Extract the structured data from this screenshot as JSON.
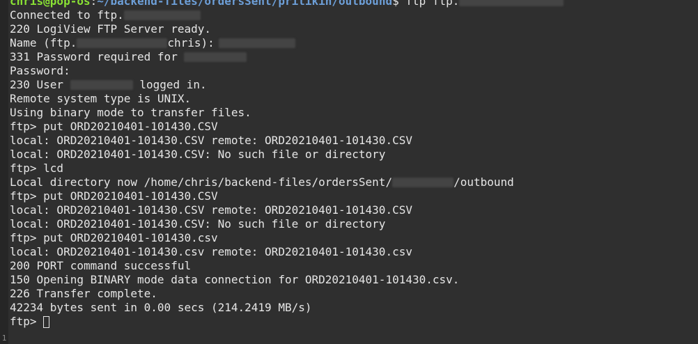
{
  "terminal": {
    "gutter_line_number": "1",
    "prompt": {
      "user_host": "chris@pop-os",
      "separator": ":",
      "path": "~/backend-files/ordersSent/pritikin/outbound",
      "symbol": "$ ",
      "command": "ftp ftp."
    },
    "lines": [
      "Connected to ftp.",
      "220 LogiView FTP Server ready.",
      "Name (ftp.",
      "chris):",
      "331 Password required for ",
      "Password:",
      "230 User ",
      " logged in.",
      "Remote system type is UNIX.",
      "Using binary mode to transfer files.",
      "ftp> put ORD20210401-101430.CSV",
      "local: ORD20210401-101430.CSV remote: ORD20210401-101430.CSV",
      "local: ORD20210401-101430.CSV: No such file or directory",
      "ftp> lcd",
      "Local directory now /home/chris/backend-files/ordersSent/",
      "/outbound",
      "ftp> put ORD20210401-101430.CSV",
      "local: ORD20210401-101430.CSV remote: ORD20210401-101430.CSV",
      "local: ORD20210401-101430.CSV: No such file or directory",
      "ftp> put ORD20210401-101430.csv",
      "local: ORD20210401-101430.csv remote: ORD20210401-101430.csv",
      "200 PORT command successful",
      "150 Opening BINARY mode data connection for ORD20210401-101430.csv.",
      "226 Transfer complete.",
      "42234 bytes sent in 0.00 secs (214.2419 MB/s)",
      "ftp> "
    ],
    "colors": {
      "background": "#2f2f2f",
      "text": "#e6e6e6",
      "prompt_user": "#8ae234",
      "prompt_path": "#6d9fd8",
      "redaction": "#444444"
    }
  }
}
